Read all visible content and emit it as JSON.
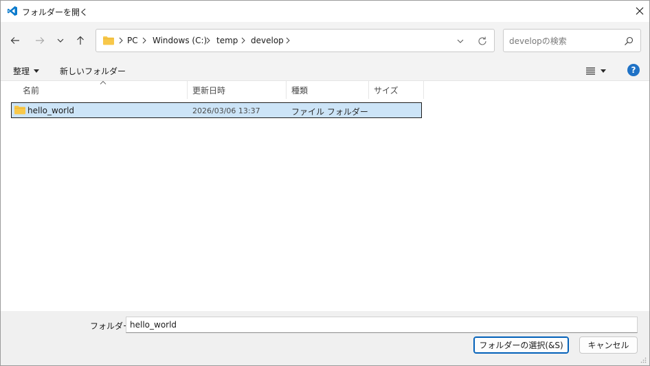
{
  "window": {
    "title": "フォルダーを開く",
    "icons": {
      "app": "vscode-logo-icon",
      "close": "close-icon"
    }
  },
  "nav": {
    "icons": [
      "back-arrow-icon",
      "forward-arrow-icon",
      "chevron-down-icon",
      "up-arrow-icon"
    ],
    "breadcrumb": [
      "PC",
      "Windows (C:)",
      "temp",
      "develop"
    ],
    "search_placeholder": "developの検索"
  },
  "commandbar": {
    "organize_label": "整理",
    "new_folder_label": "新しいフォルダー",
    "help_label": "?"
  },
  "columns": {
    "name": "名前",
    "modified": "更新日時",
    "type": "種類",
    "size": "サイズ"
  },
  "files": [
    {
      "name": "hello_world",
      "modified": "2026/03/06 13:37",
      "type": "ファイル フォルダー",
      "size": "",
      "selected": true
    }
  ],
  "footer": {
    "folder_label": "フォルダー:",
    "folder_value": "hello_world",
    "select_button": "フォルダーの選択(&S)",
    "cancel_button": "キャンセル"
  },
  "colors": {
    "accent": "#005fb8",
    "selection": "#cce4f7",
    "folder_yellow": "#f8c84a",
    "help_blue": "#1f72c6",
    "panel_bg": "#f3f3f3"
  }
}
